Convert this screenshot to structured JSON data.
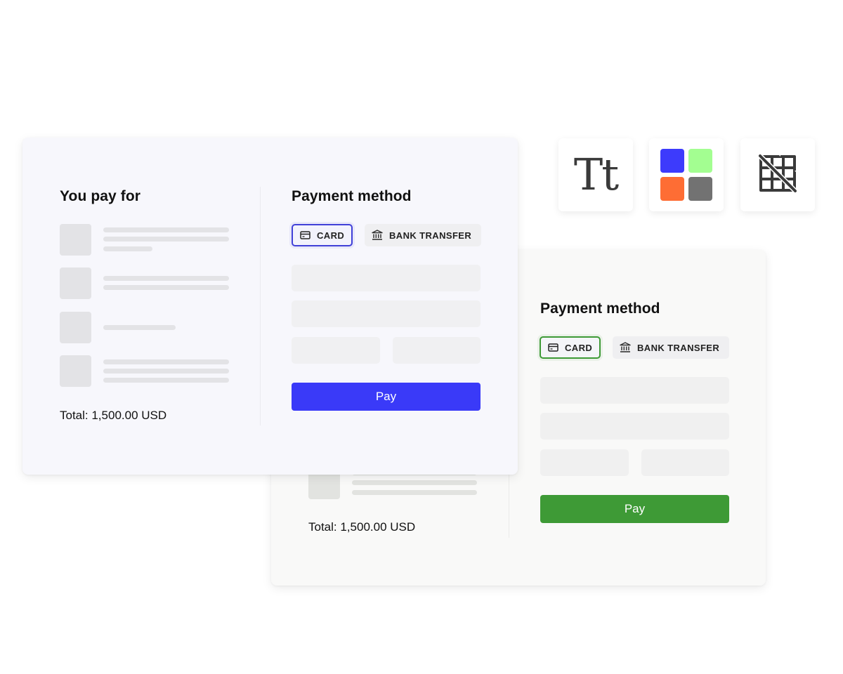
{
  "colors": {
    "primary_blue": "#3a3af8",
    "primary_green": "#3e9a36",
    "swatch_blue": "#3d3bfc",
    "swatch_green": "#a3fe91",
    "swatch_orange": "#fe6d34",
    "swatch_gray": "#727272"
  },
  "toolbar": {
    "tiles": [
      {
        "icon": "typography-icon",
        "glyph": "Tt"
      },
      {
        "icon": "color-palette-icon"
      },
      {
        "icon": "grid-off-icon"
      }
    ]
  },
  "checkout_blue": {
    "summary": {
      "heading": "You pay for",
      "total": "Total: 1,500.00 USD"
    },
    "payment": {
      "heading": "Payment method",
      "tabs": [
        {
          "label": "CARD",
          "icon": "credit-card-icon",
          "active": true
        },
        {
          "label": "BANK TRANSFER",
          "icon": "bank-icon",
          "active": false
        }
      ],
      "pay_label": "Pay"
    }
  },
  "checkout_green": {
    "summary": {
      "total": "Total: 1,500.00 USD"
    },
    "payment": {
      "heading": "Payment method",
      "tabs": [
        {
          "label": "CARD",
          "icon": "credit-card-icon",
          "active": true
        },
        {
          "label": "BANK TRANSFER",
          "icon": "bank-icon",
          "active": false
        }
      ],
      "pay_label": "Pay"
    }
  }
}
